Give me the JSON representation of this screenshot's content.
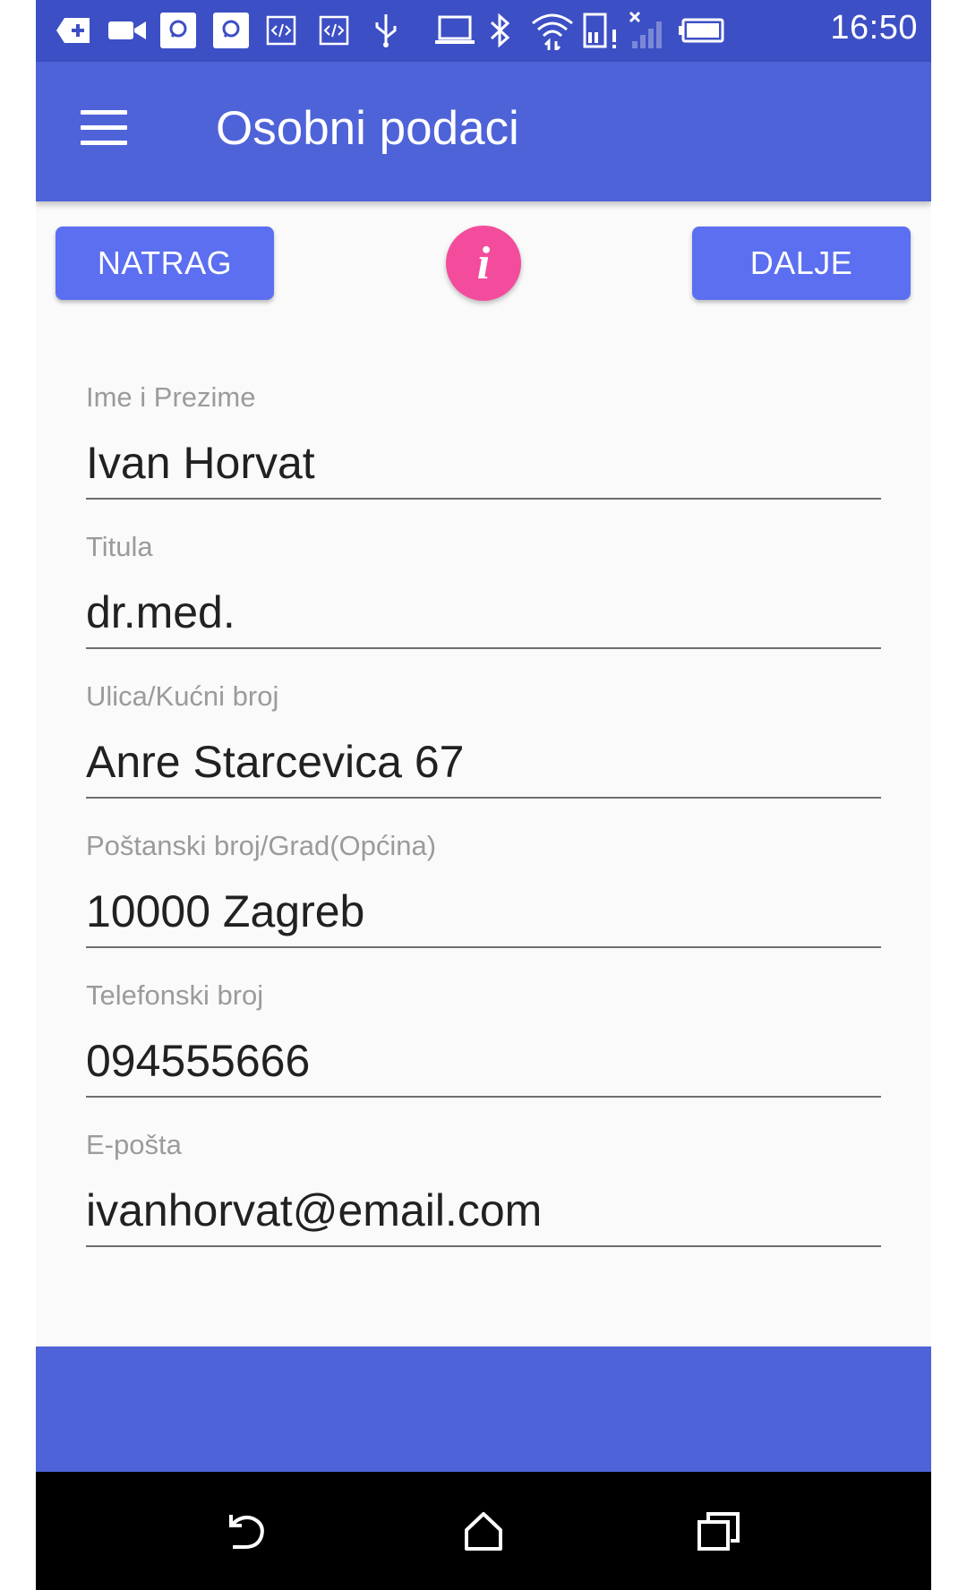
{
  "status_bar": {
    "time": "16:50",
    "icons": [
      "add-icon",
      "video-camera-icon",
      "app-icon",
      "app-icon",
      "code-icon",
      "code-icon",
      "usb-icon",
      "laptop-icon",
      "bluetooth-icon",
      "wifi-icon",
      "sd-card-alert-icon",
      "signal-icon",
      "battery-icon"
    ]
  },
  "app_bar": {
    "title": "Osobni podaci",
    "menu_icon": "hamburger-menu-icon"
  },
  "actions": {
    "back_label": "NATRAG",
    "next_label": "DALJE",
    "info_label": "i"
  },
  "form": {
    "fields": [
      {
        "label": "Ime i Prezime",
        "value": "Ivan Horvat"
      },
      {
        "label": "Titula",
        "value": "dr.med."
      },
      {
        "label": "Ulica/Kućni broj",
        "value": "Anre Starcevica 67"
      },
      {
        "label": "Poštanski broj/Grad(Općina)",
        "value": "10000 Zagreb"
      },
      {
        "label": "Telefonski broj",
        "value": "094555666"
      },
      {
        "label": "E-pošta",
        "value": "ivanhorvat@email.com"
      }
    ]
  },
  "colors": {
    "status_bar": "#3d4fc4",
    "primary": "#4f63d8",
    "button": "#5b6ff0",
    "accent": "#f34c9d",
    "background": "#fafafa"
  },
  "nav_bar": {
    "icons": [
      "back-icon",
      "home-icon",
      "recents-icon"
    ]
  }
}
